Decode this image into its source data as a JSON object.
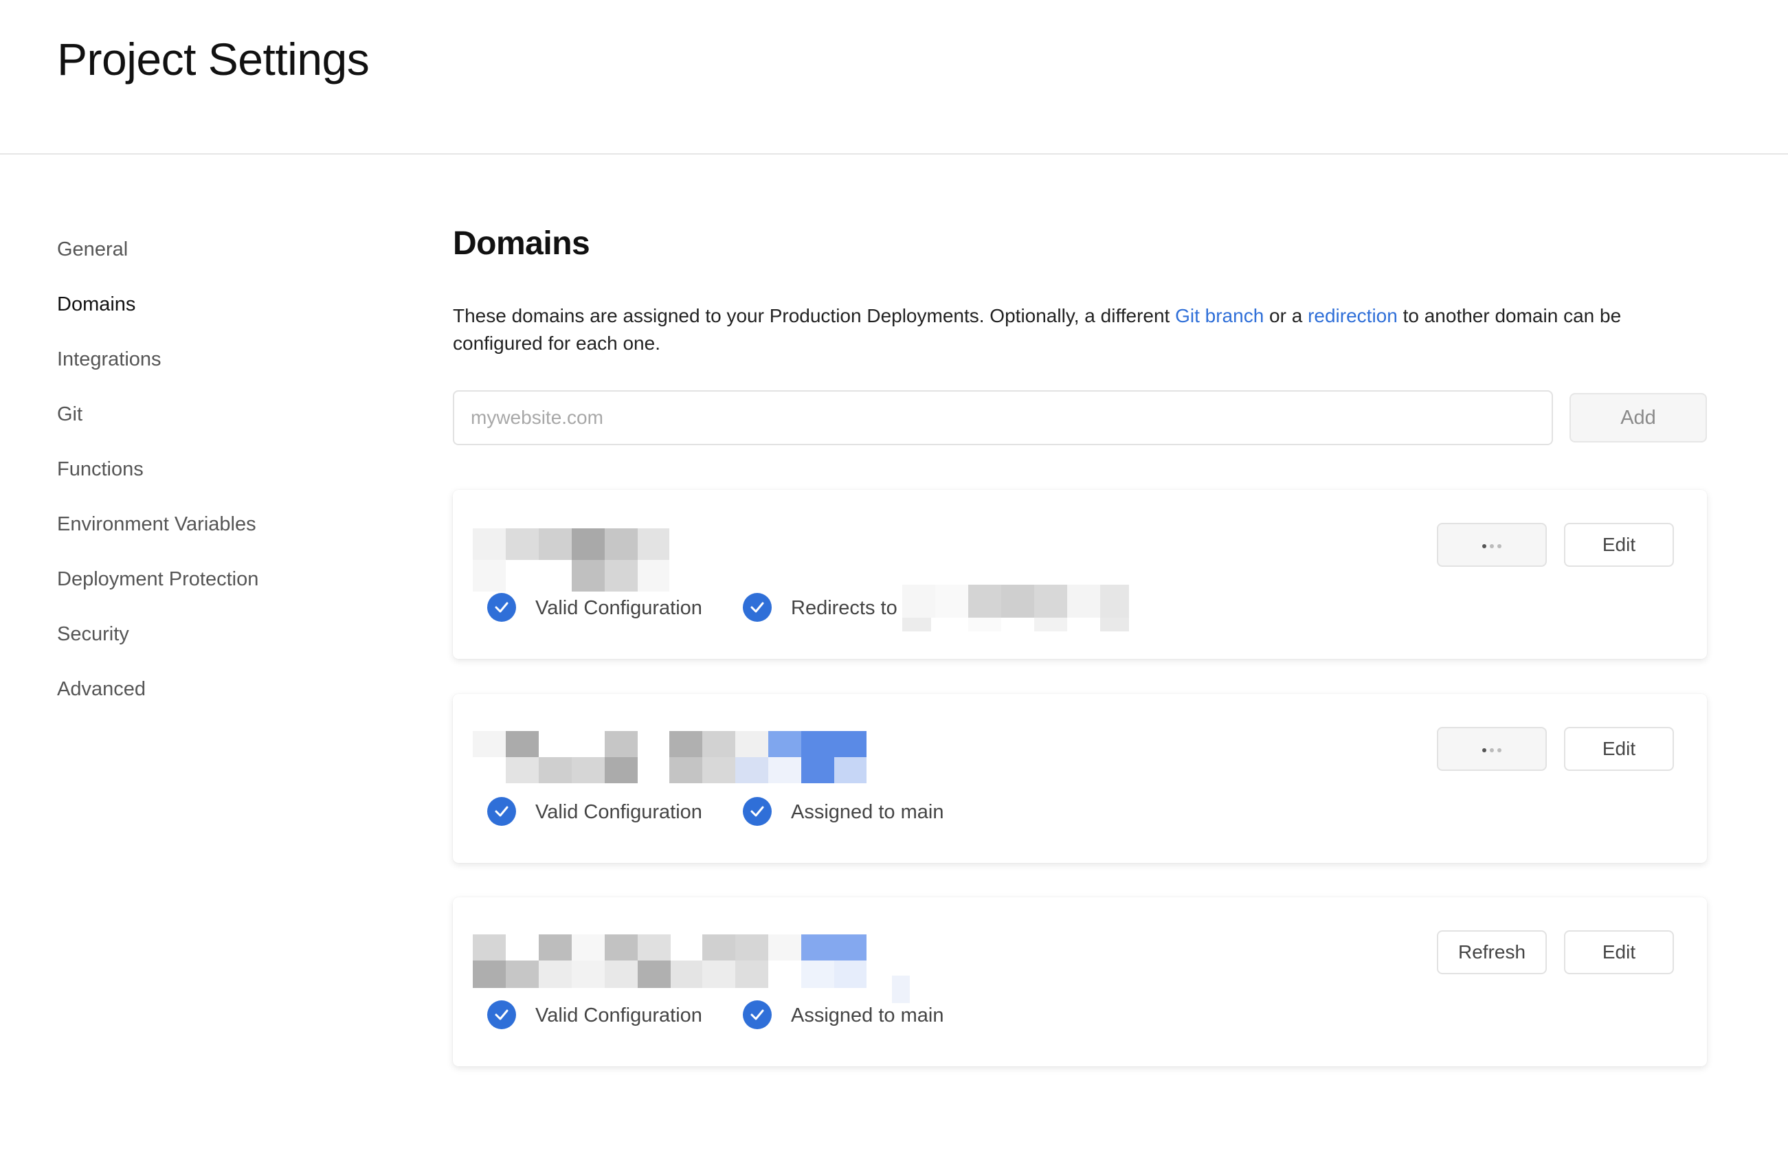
{
  "header": {
    "title": "Project Settings"
  },
  "sidebar": {
    "items": [
      {
        "label": "General"
      },
      {
        "label": "Domains"
      },
      {
        "label": "Integrations"
      },
      {
        "label": "Git"
      },
      {
        "label": "Functions"
      },
      {
        "label": "Environment Variables"
      },
      {
        "label": "Deployment Protection"
      },
      {
        "label": "Security"
      },
      {
        "label": "Advanced"
      }
    ],
    "active": "Domains"
  },
  "main": {
    "title": "Domains",
    "description": {
      "part1": "These domains are assigned to your Production Deployments. Optionally, a different ",
      "link1": "Git branch",
      "part2": " or a ",
      "link2": "redirection",
      "part3": " to another domain can be configured for each one."
    },
    "input": {
      "placeholder": "mywebsite.com",
      "value": ""
    },
    "add_label": "Add",
    "domains": [
      {
        "checks": [
          {
            "label": "Valid Configuration"
          },
          {
            "label": "Redirects to"
          }
        ],
        "left_button": "more-options",
        "edit_label": "Edit"
      },
      {
        "checks": [
          {
            "label": "Valid Configuration"
          },
          {
            "label": "Assigned to main"
          }
        ],
        "left_button": "more-options",
        "edit_label": "Edit"
      },
      {
        "checks": [
          {
            "label": "Valid Configuration"
          },
          {
            "label": "Assigned to main"
          }
        ],
        "left_button": "refresh",
        "refresh_label": "Refresh",
        "edit_label": "Edit"
      }
    ]
  },
  "colors": {
    "accent": "#2f6fd8",
    "border": "#e2e2e2",
    "muted_text": "#555555"
  },
  "icons": {
    "check": "check-circle-icon",
    "more": "ellipsis-icon"
  }
}
